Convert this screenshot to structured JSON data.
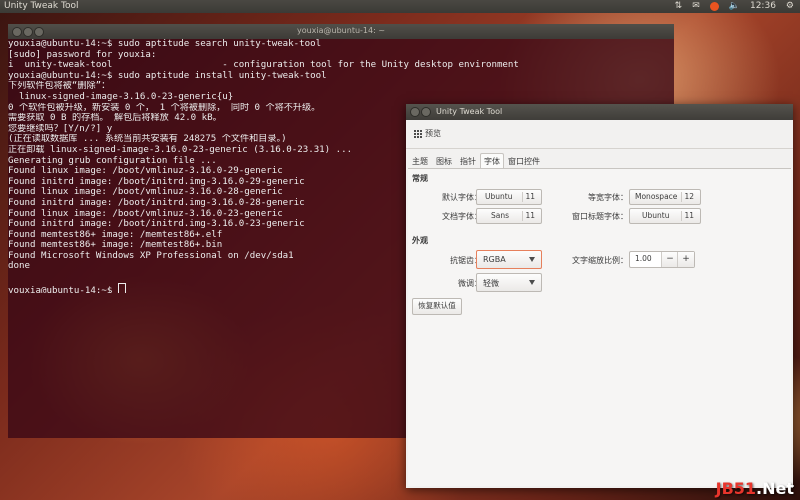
{
  "panel": {
    "title": "Unity Tweak Tool",
    "clock": "12:36"
  },
  "terminal": {
    "title": "youxia@ubuntu-14: ~",
    "lines": [
      "youxia@ubuntu-14:~$ sudo aptitude search unity-tweak-tool",
      "[sudo] password for youxia:",
      "i  unity-tweak-tool                    - configuration tool for the Unity desktop environment",
      "youxia@ubuntu-14:~$ sudo aptitude install unity-tweak-tool",
      "下列软件包将被“删除”：",
      "  linux-signed-image-3.16.0-23-generic{u}",
      "0 个软件包被升级，新安装 0 个， 1 个将被删除， 同时 0 个将不升级。",
      "需要获取 0 B 的存档。 解包后将释放 42.0 kB。",
      "您要继续吗？[Y/n/?] y",
      "(正在读取数据库 ... 系统当前共安装有 248275 个文件和目录。)",
      "正在卸载 linux-signed-image-3.16.0-23-generic (3.16.0-23.31) ...",
      "Generating grub configuration file ...",
      "Found linux image: /boot/vmlinuz-3.16.0-29-generic",
      "Found initrd image: /boot/initrd.img-3.16.0-29-generic",
      "Found linux image: /boot/vmlinuz-3.16.0-28-generic",
      "Found initrd image: /boot/initrd.img-3.16.0-28-generic",
      "Found linux image: /boot/vmlinuz-3.16.0-23-generic",
      "Found initrd image: /boot/initrd.img-3.16.0-23-generic",
      "Found memtest86+ image: /memtest86+.elf",
      "Found memtest86+ image: /memtest86+.bin",
      "Found Microsoft Windows XP Professional on /dev/sda1",
      "done",
      "",
      "youxia@ubuntu-14:~$ "
    ]
  },
  "tweak": {
    "title": "Unity Tweak Tool",
    "overview_label": "预览",
    "tabs": [
      "主题",
      "图标",
      "指针",
      "字体",
      "窗口控件"
    ],
    "active_tab": "字体",
    "general": {
      "heading": "常规",
      "default_font_label": "默认字体：",
      "default_font": {
        "name": "Ubuntu",
        "size": "11"
      },
      "mono_font_label": "等宽字体：",
      "mono_font": {
        "name": "Monospace",
        "size": "12"
      },
      "doc_font_label": "文档字体：",
      "doc_font": {
        "name": "Sans",
        "size": "11"
      },
      "title_font_label": "窗口标题字体：",
      "title_font": {
        "name": "Ubuntu",
        "size": "11"
      }
    },
    "appearance": {
      "heading": "外观",
      "antialias_label": "抗锯齿：",
      "antialias_value": "RGBA",
      "hinting_label": "微调：",
      "hinting_value": "轻微",
      "scale_label": "文字缩放比例：",
      "scale_value": "1.00",
      "minus": "−",
      "plus": "+"
    },
    "reset_label": "恢复默认值"
  },
  "watermark": {
    "left": "JB51",
    "right": ".Net"
  },
  "colors": {
    "accent": "#e95420",
    "terminal_bg": "#3a0816"
  }
}
